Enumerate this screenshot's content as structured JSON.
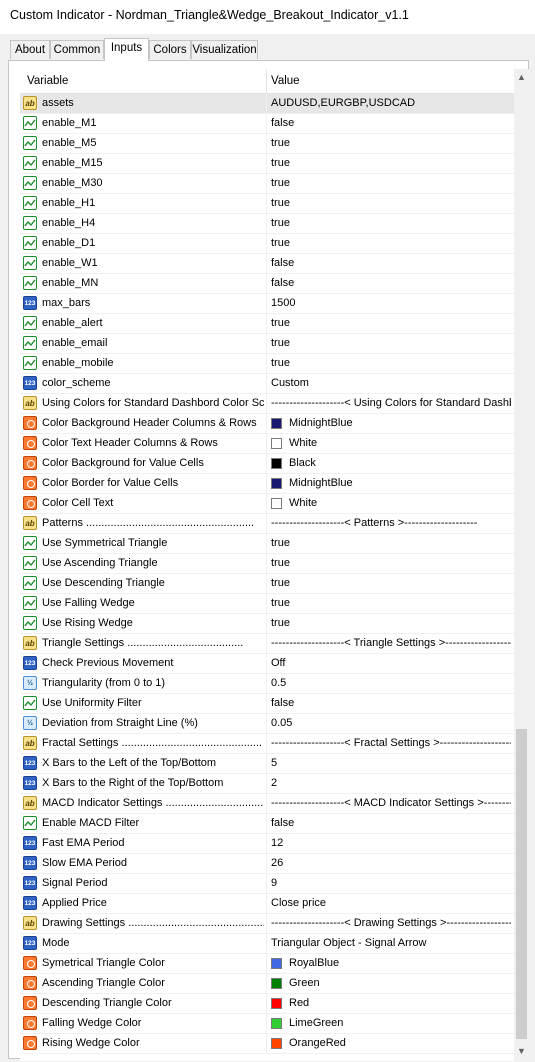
{
  "window": {
    "title": "Custom Indicator - Nordman_Triangle&Wedge_Breakout_Indicator_v1.1"
  },
  "tabs": [
    {
      "label": "About",
      "active": false
    },
    {
      "label": "Common",
      "active": false
    },
    {
      "label": "Inputs",
      "active": true
    },
    {
      "label": "Colors",
      "active": false
    },
    {
      "label": "Visualization",
      "active": false
    }
  ],
  "grid": {
    "col_variable": "Variable",
    "col_value": "Value",
    "rows": [
      {
        "icon": "ab",
        "name": "assets",
        "value": "AUDUSD,EURGBP,USDCAD",
        "selected": true
      },
      {
        "icon": "bool",
        "name": "enable_M1",
        "value": "false"
      },
      {
        "icon": "bool",
        "name": "enable_M5",
        "value": "true"
      },
      {
        "icon": "bool",
        "name": "enable_M15",
        "value": "true"
      },
      {
        "icon": "bool",
        "name": "enable_M30",
        "value": "true"
      },
      {
        "icon": "bool",
        "name": "enable_H1",
        "value": "true"
      },
      {
        "icon": "bool",
        "name": "enable_H4",
        "value": "true"
      },
      {
        "icon": "bool",
        "name": "enable_D1",
        "value": "true"
      },
      {
        "icon": "bool",
        "name": "enable_W1",
        "value": "false"
      },
      {
        "icon": "bool",
        "name": "enable_MN",
        "value": "false"
      },
      {
        "icon": "num",
        "name": "max_bars",
        "value": "1500"
      },
      {
        "icon": "bool",
        "name": "enable_alert",
        "value": "true"
      },
      {
        "icon": "bool",
        "name": "enable_email",
        "value": "true"
      },
      {
        "icon": "bool",
        "name": "enable_mobile",
        "value": "true"
      },
      {
        "icon": "num",
        "name": "color_scheme",
        "value": "Custom"
      },
      {
        "icon": "ab",
        "name": "Using Colors for Standard Dashbord Color Sc...",
        "value": "--------------------< Using Colors for Standard Dashbo..."
      },
      {
        "icon": "color",
        "name": "Color Background Header Columns & Rows",
        "value": "MidnightBlue",
        "swatch": "#191970"
      },
      {
        "icon": "color",
        "name": "Color Text Header Columns & Rows",
        "value": "White",
        "swatch": "#ffffff"
      },
      {
        "icon": "color",
        "name": "Color Background for Value Cells",
        "value": "Black",
        "swatch": "#000000"
      },
      {
        "icon": "color",
        "name": "Color Border for Value Cells",
        "value": "MidnightBlue",
        "swatch": "#191970"
      },
      {
        "icon": "color",
        "name": "Color Cell Text",
        "value": "White",
        "swatch": "#ffffff"
      },
      {
        "icon": "ab",
        "name": "Patterns .......................................................",
        "value": "--------------------< Patterns >--------------------"
      },
      {
        "icon": "bool",
        "name": "Use Symmetrical Triangle",
        "value": "true"
      },
      {
        "icon": "bool",
        "name": "Use Ascending Triangle",
        "value": "true"
      },
      {
        "icon": "bool",
        "name": "Use Descending Triangle",
        "value": "true"
      },
      {
        "icon": "bool",
        "name": "Use Falling Wedge",
        "value": "true"
      },
      {
        "icon": "bool",
        "name": "Use Rising Wedge",
        "value": "true"
      },
      {
        "icon": "ab",
        "name": "Triangle Settings ......................................",
        "value": "--------------------< Triangle Settings >--------------------"
      },
      {
        "icon": "num",
        "name": "Check Previous Movement",
        "value": "Off"
      },
      {
        "icon": "frac",
        "name": "Triangularity (from 0 to 1)",
        "value": "0.5"
      },
      {
        "icon": "bool",
        "name": "Use Uniformity Filter",
        "value": "false"
      },
      {
        "icon": "frac",
        "name": "Deviation from Straight Line (%)",
        "value": "0.05"
      },
      {
        "icon": "ab",
        "name": "Fractal Settings ..............................................",
        "value": "--------------------< Fractal Settings >--------------------"
      },
      {
        "icon": "num",
        "name": "X Bars to the Left of the Top/Bottom",
        "value": "5"
      },
      {
        "icon": "num",
        "name": "X Bars to the Right of the Top/Bottom",
        "value": "2"
      },
      {
        "icon": "ab",
        "name": "MACD Indicator Settings .................................",
        "value": "--------------------< MACD Indicator Settings >-------------"
      },
      {
        "icon": "bool",
        "name": "Enable MACD Filter",
        "value": "false"
      },
      {
        "icon": "num",
        "name": "Fast EMA Period",
        "value": "12"
      },
      {
        "icon": "num",
        "name": "Slow EMA Period",
        "value": "26"
      },
      {
        "icon": "num",
        "name": "Signal Period",
        "value": "9"
      },
      {
        "icon": "num",
        "name": "Applied Price",
        "value": "Close price"
      },
      {
        "icon": "ab",
        "name": "Drawing Settings ..............................................",
        "value": "--------------------< Drawing Settings >--------------------"
      },
      {
        "icon": "num",
        "name": "Mode",
        "value": "Triangular Object - Signal Arrow"
      },
      {
        "icon": "color",
        "name": "Symetrical Triangle Color",
        "value": "RoyalBlue",
        "swatch": "#4169e1"
      },
      {
        "icon": "color",
        "name": "Ascending Triangle Color",
        "value": "Green",
        "swatch": "#008000"
      },
      {
        "icon": "color",
        "name": "Descending Triangle Color",
        "value": "Red",
        "swatch": "#ff0000"
      },
      {
        "icon": "color",
        "name": "Falling Wedge Color",
        "value": "LimeGreen",
        "swatch": "#32cd32"
      },
      {
        "icon": "color",
        "name": "Rising Wedge Color",
        "value": "OrangeRed",
        "swatch": "#ff4500"
      }
    ]
  },
  "scrollbar": {
    "up_icon": "chevron-up-icon",
    "down_icon": "chevron-down-icon"
  }
}
